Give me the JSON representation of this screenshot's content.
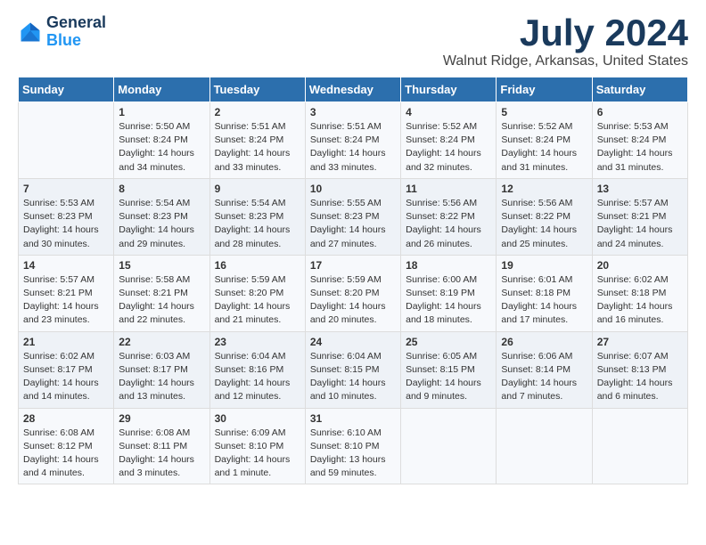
{
  "logo": {
    "line1": "General",
    "line2": "Blue"
  },
  "title": "July 2024",
  "subtitle": "Walnut Ridge, Arkansas, United States",
  "days_of_week": [
    "Sunday",
    "Monday",
    "Tuesday",
    "Wednesday",
    "Thursday",
    "Friday",
    "Saturday"
  ],
  "weeks": [
    [
      {
        "day": "",
        "sunrise": "",
        "sunset": "",
        "daylight": ""
      },
      {
        "day": "1",
        "sunrise": "Sunrise: 5:50 AM",
        "sunset": "Sunset: 8:24 PM",
        "daylight": "Daylight: 14 hours and 34 minutes."
      },
      {
        "day": "2",
        "sunrise": "Sunrise: 5:51 AM",
        "sunset": "Sunset: 8:24 PM",
        "daylight": "Daylight: 14 hours and 33 minutes."
      },
      {
        "day": "3",
        "sunrise": "Sunrise: 5:51 AM",
        "sunset": "Sunset: 8:24 PM",
        "daylight": "Daylight: 14 hours and 33 minutes."
      },
      {
        "day": "4",
        "sunrise": "Sunrise: 5:52 AM",
        "sunset": "Sunset: 8:24 PM",
        "daylight": "Daylight: 14 hours and 32 minutes."
      },
      {
        "day": "5",
        "sunrise": "Sunrise: 5:52 AM",
        "sunset": "Sunset: 8:24 PM",
        "daylight": "Daylight: 14 hours and 31 minutes."
      },
      {
        "day": "6",
        "sunrise": "Sunrise: 5:53 AM",
        "sunset": "Sunset: 8:24 PM",
        "daylight": "Daylight: 14 hours and 31 minutes."
      }
    ],
    [
      {
        "day": "7",
        "sunrise": "Sunrise: 5:53 AM",
        "sunset": "Sunset: 8:23 PM",
        "daylight": "Daylight: 14 hours and 30 minutes."
      },
      {
        "day": "8",
        "sunrise": "Sunrise: 5:54 AM",
        "sunset": "Sunset: 8:23 PM",
        "daylight": "Daylight: 14 hours and 29 minutes."
      },
      {
        "day": "9",
        "sunrise": "Sunrise: 5:54 AM",
        "sunset": "Sunset: 8:23 PM",
        "daylight": "Daylight: 14 hours and 28 minutes."
      },
      {
        "day": "10",
        "sunrise": "Sunrise: 5:55 AM",
        "sunset": "Sunset: 8:23 PM",
        "daylight": "Daylight: 14 hours and 27 minutes."
      },
      {
        "day": "11",
        "sunrise": "Sunrise: 5:56 AM",
        "sunset": "Sunset: 8:22 PM",
        "daylight": "Daylight: 14 hours and 26 minutes."
      },
      {
        "day": "12",
        "sunrise": "Sunrise: 5:56 AM",
        "sunset": "Sunset: 8:22 PM",
        "daylight": "Daylight: 14 hours and 25 minutes."
      },
      {
        "day": "13",
        "sunrise": "Sunrise: 5:57 AM",
        "sunset": "Sunset: 8:21 PM",
        "daylight": "Daylight: 14 hours and 24 minutes."
      }
    ],
    [
      {
        "day": "14",
        "sunrise": "Sunrise: 5:57 AM",
        "sunset": "Sunset: 8:21 PM",
        "daylight": "Daylight: 14 hours and 23 minutes."
      },
      {
        "day": "15",
        "sunrise": "Sunrise: 5:58 AM",
        "sunset": "Sunset: 8:21 PM",
        "daylight": "Daylight: 14 hours and 22 minutes."
      },
      {
        "day": "16",
        "sunrise": "Sunrise: 5:59 AM",
        "sunset": "Sunset: 8:20 PM",
        "daylight": "Daylight: 14 hours and 21 minutes."
      },
      {
        "day": "17",
        "sunrise": "Sunrise: 5:59 AM",
        "sunset": "Sunset: 8:20 PM",
        "daylight": "Daylight: 14 hours and 20 minutes."
      },
      {
        "day": "18",
        "sunrise": "Sunrise: 6:00 AM",
        "sunset": "Sunset: 8:19 PM",
        "daylight": "Daylight: 14 hours and 18 minutes."
      },
      {
        "day": "19",
        "sunrise": "Sunrise: 6:01 AM",
        "sunset": "Sunset: 8:18 PM",
        "daylight": "Daylight: 14 hours and 17 minutes."
      },
      {
        "day": "20",
        "sunrise": "Sunrise: 6:02 AM",
        "sunset": "Sunset: 8:18 PM",
        "daylight": "Daylight: 14 hours and 16 minutes."
      }
    ],
    [
      {
        "day": "21",
        "sunrise": "Sunrise: 6:02 AM",
        "sunset": "Sunset: 8:17 PM",
        "daylight": "Daylight: 14 hours and 14 minutes."
      },
      {
        "day": "22",
        "sunrise": "Sunrise: 6:03 AM",
        "sunset": "Sunset: 8:17 PM",
        "daylight": "Daylight: 14 hours and 13 minutes."
      },
      {
        "day": "23",
        "sunrise": "Sunrise: 6:04 AM",
        "sunset": "Sunset: 8:16 PM",
        "daylight": "Daylight: 14 hours and 12 minutes."
      },
      {
        "day": "24",
        "sunrise": "Sunrise: 6:04 AM",
        "sunset": "Sunset: 8:15 PM",
        "daylight": "Daylight: 14 hours and 10 minutes."
      },
      {
        "day": "25",
        "sunrise": "Sunrise: 6:05 AM",
        "sunset": "Sunset: 8:15 PM",
        "daylight": "Daylight: 14 hours and 9 minutes."
      },
      {
        "day": "26",
        "sunrise": "Sunrise: 6:06 AM",
        "sunset": "Sunset: 8:14 PM",
        "daylight": "Daylight: 14 hours and 7 minutes."
      },
      {
        "day": "27",
        "sunrise": "Sunrise: 6:07 AM",
        "sunset": "Sunset: 8:13 PM",
        "daylight": "Daylight: 14 hours and 6 minutes."
      }
    ],
    [
      {
        "day": "28",
        "sunrise": "Sunrise: 6:08 AM",
        "sunset": "Sunset: 8:12 PM",
        "daylight": "Daylight: 14 hours and 4 minutes."
      },
      {
        "day": "29",
        "sunrise": "Sunrise: 6:08 AM",
        "sunset": "Sunset: 8:11 PM",
        "daylight": "Daylight: 14 hours and 3 minutes."
      },
      {
        "day": "30",
        "sunrise": "Sunrise: 6:09 AM",
        "sunset": "Sunset: 8:10 PM",
        "daylight": "Daylight: 14 hours and 1 minute."
      },
      {
        "day": "31",
        "sunrise": "Sunrise: 6:10 AM",
        "sunset": "Sunset: 8:10 PM",
        "daylight": "Daylight: 13 hours and 59 minutes."
      },
      {
        "day": "",
        "sunrise": "",
        "sunset": "",
        "daylight": ""
      },
      {
        "day": "",
        "sunrise": "",
        "sunset": "",
        "daylight": ""
      },
      {
        "day": "",
        "sunrise": "",
        "sunset": "",
        "daylight": ""
      }
    ]
  ]
}
